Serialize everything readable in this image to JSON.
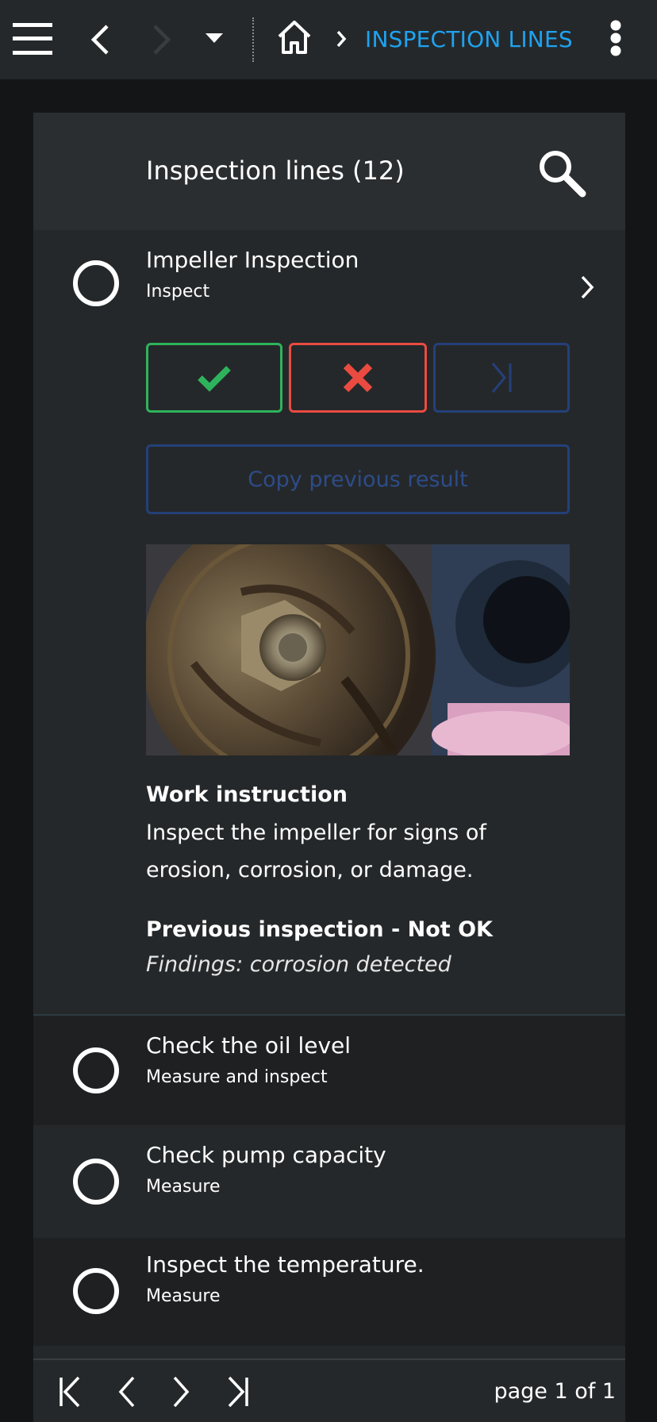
{
  "topbar": {
    "menu_icon": "hamburger-icon",
    "back_icon": "chevron-left-icon",
    "forward_icon": "chevron-right-icon",
    "dropdown_icon": "caret-down-icon",
    "home_icon": "home-icon",
    "breadcrumb_separator_icon": "chevron-right-icon",
    "breadcrumb_label": "INSPECTION LINES",
    "more_icon": "kebab-menu-icon"
  },
  "list": {
    "title": "Inspection lines (12)",
    "search_icon": "search-icon",
    "expanded": {
      "title": "Impeller Inspection",
      "subtitle": "Inspect",
      "actions": {
        "ok_icon": "check-icon",
        "not_ok_icon": "cross-icon",
        "skip_icon": "skip-to-end-icon"
      },
      "copy_previous_label": "Copy previous result",
      "work_instruction_title": "Work instruction",
      "work_instruction_text": "Inspect the impeller for signs of erosion, corrosion, or damage.",
      "previous_inspection_title": "Previous inspection - Not OK",
      "previous_findings": "Findings: corrosion detected"
    },
    "items": [
      {
        "title": "Check the oil level",
        "subtitle": "Measure and inspect"
      },
      {
        "title": "Check pump capacity",
        "subtitle": "Measure"
      },
      {
        "title": "Inspect the temperature.",
        "subtitle": "Measure"
      }
    ]
  },
  "pager": {
    "first_icon": "first-page-icon",
    "prev_icon": "chevron-left-icon",
    "next_icon": "chevron-right-icon",
    "last_icon": "last-page-icon",
    "page_label": "page 1 of 1"
  },
  "colors": {
    "accent": "#1ea3f0",
    "ok": "#2eb35c",
    "not_ok": "#ea4b41",
    "disabled_blue": "#24407a",
    "background": "#141516",
    "surface": "#25282a"
  }
}
